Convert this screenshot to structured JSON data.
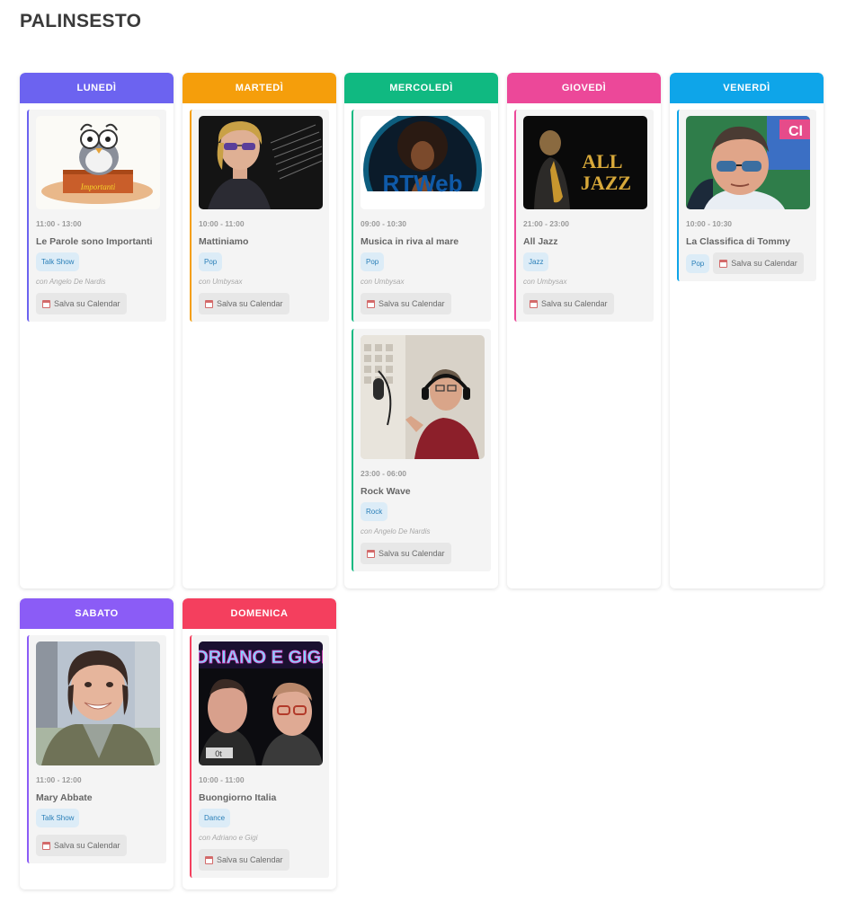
{
  "page": {
    "title": "PALINSESTO"
  },
  "calendar_label": "Salva su Calendar",
  "days": {
    "lun": {
      "name": "LUNEDÌ",
      "color": "#6c63f0",
      "shows": [
        {
          "time": "11:00 - 13:00",
          "title": "Le Parole sono Importanti",
          "tags": [
            "Talk Show"
          ],
          "host": "con Angelo De Nardis",
          "image": "cartoon-owl-at-desk"
        }
      ]
    },
    "mar": {
      "name": "MARTEDÌ",
      "color": "#f59e0b",
      "shows": [
        {
          "time": "10:00 - 11:00",
          "title": "Mattiniamo",
          "tags": [
            "Pop"
          ],
          "host": "con Umbysax",
          "image": "man-with-tinted-glasses"
        }
      ]
    },
    "mer": {
      "name": "MERCOLEDÌ",
      "color": "#10b981",
      "shows": [
        {
          "time": "09:00 - 10:30",
          "title": "Musica in riva al mare",
          "tags": [
            "Pop"
          ],
          "host": "con Umbysax",
          "image": "rtweb-logo",
          "image_text": "RTWeb"
        },
        {
          "time": "23:00 - 06:00",
          "title": "Rock Wave",
          "tags": [
            "Rock"
          ],
          "host": "con Angelo De Nardis",
          "image": "man-in-radio-studio"
        }
      ]
    },
    "gio": {
      "name": "GIOVEDÌ",
      "color": "#ec4899",
      "shows": [
        {
          "time": "21:00 - 23:00",
          "title": "All Jazz",
          "tags": [
            "Jazz"
          ],
          "host": "con Umbysax",
          "image": "all-jazz-saxophonist",
          "image_text_1": "ALL",
          "image_text_2": "JAZZ"
        }
      ]
    },
    "ven": {
      "name": "VENERDÌ",
      "color": "#0ea5e9",
      "shows": [
        {
          "time": "10:00 - 10:30",
          "title": "La Classifica di Tommy",
          "tags": [
            "Pop"
          ],
          "host": "",
          "image": "man-with-sunglasses"
        }
      ]
    },
    "sab": {
      "name": "SABATO",
      "color": "#8b5cf6",
      "shows": [
        {
          "time": "11:00 - 12:00",
          "title": "Mary Abbate",
          "tags": [
            "Talk Show"
          ],
          "host": "",
          "image": "smiling-woman"
        }
      ]
    },
    "dom": {
      "name": "DOMENICA",
      "color": "#f43f5e",
      "shows": [
        {
          "time": "10:00 - 11:00",
          "title": "Buongiorno Italia",
          "tags": [
            "Dance"
          ],
          "host": "con Adriano e Gigi",
          "image": "two-hosts-selfie",
          "image_text": "DRIANO E GIGI"
        }
      ]
    }
  }
}
